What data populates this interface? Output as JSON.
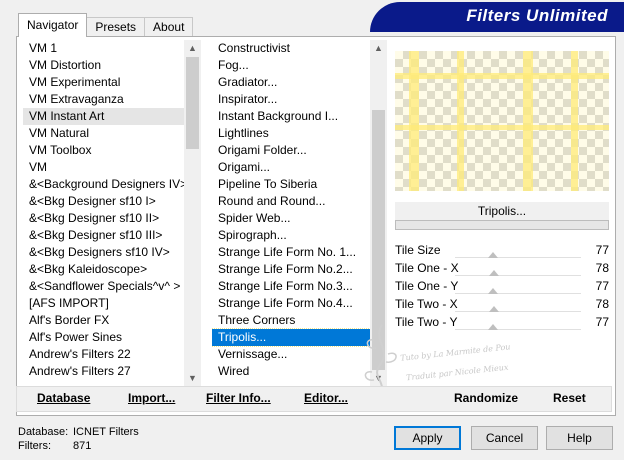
{
  "tabs": [
    "Navigator",
    "Presets",
    "About"
  ],
  "banner": "Filters Unlimited",
  "categories": {
    "selected": "VM Instant Art",
    "items": [
      "VM 1",
      "VM Distortion",
      "VM Experimental",
      "VM Extravaganza",
      "VM Instant Art",
      "VM Natural",
      "VM Toolbox",
      "VM",
      "&<Background Designers IV>",
      "&<Bkg Designer sf10 I>",
      "&<Bkg Designer sf10 II>",
      "&<Bkg Designer sf10 III>",
      "&<Bkg Designers sf10 IV>",
      "&<Bkg Kaleidoscope>",
      "&<Sandflower Specials^v^ >",
      "[AFS IMPORT]",
      "Alf's Border FX",
      "Alf's Power Sines",
      "Andrew's Filters 22",
      "Andrew's Filters 27"
    ]
  },
  "filters": {
    "selected": "Tripolis...",
    "items": [
      "Constructivist",
      "Fog...",
      "Gradiator...",
      "Inspirator...",
      "Instant Background I...",
      "Lightlines",
      "Origami Folder...",
      "Origami...",
      "Pipeline To Siberia",
      "Round and Round...",
      "Spider Web...",
      "Spirograph...",
      "Strange Life Form No. 1...",
      "Strange Life Form No.2...",
      "Strange Life Form No.3...",
      "Strange Life Form No.4...",
      "Three Corners",
      "Tripolis...",
      "Vernissage...",
      "Wired"
    ]
  },
  "preview_filter_name": "Tripolis...",
  "parameters": [
    {
      "label": "Tile Size",
      "value": "77",
      "fraction": 0.3
    },
    {
      "label": "Tile One - X",
      "value": "78",
      "fraction": 0.31
    },
    {
      "label": "Tile One - Y",
      "value": "77",
      "fraction": 0.3
    },
    {
      "label": "Tile Two - X",
      "value": "78",
      "fraction": 0.31
    },
    {
      "label": "Tile Two - Y",
      "value": "77",
      "fraction": 0.3
    }
  ],
  "watermark": {
    "line1": "Tuto by La Marmite de Pou",
    "line2": "Traduit par Nicole Mieux"
  },
  "toolbar": {
    "database": "Database",
    "import": "Import...",
    "filter_info": "Filter Info...",
    "editor": "Editor...",
    "randomize": "Randomize",
    "reset": "Reset"
  },
  "info": {
    "database_label": "Database:",
    "database_value": "ICNET Filters",
    "filters_label": "Filters:",
    "filters_value": "871"
  },
  "buttons": {
    "apply": "Apply",
    "cancel": "Cancel",
    "help": "Help"
  },
  "colors": {
    "banner": "#0a1a8a",
    "selection": "#0078d7",
    "preview_tint": "#ffeb78"
  }
}
